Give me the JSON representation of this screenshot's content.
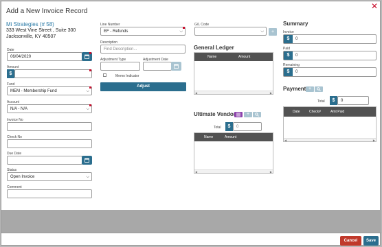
{
  "dialog": {
    "title": "Add a New Invoice Record"
  },
  "vendor": {
    "name": "Mi Strategies (# 58)",
    "address1": "333 West Vine Street , Suite 300",
    "address2": "Jacksonville, KY 40507"
  },
  "left": {
    "date_label": "Date",
    "date_value": "06/04/2020",
    "amount_label": "Amount",
    "amount_value": "",
    "fund_label": "Fund",
    "fund_value": "MEM - Membership Fund",
    "account_label": "Account",
    "account_value": "N/A - N/A",
    "invoice_no_label": "Invoice No",
    "check_no_label": "Check No",
    "due_date_label": "Due Date",
    "status_label": "Status",
    "status_value": "Open Invoice",
    "comment_label": "Comment"
  },
  "middle": {
    "line_number_label": "Line Number",
    "line_number_value": "EF - Refunds",
    "description_label": "Description",
    "description_placeholder": "Find Description...",
    "adj_type_label": "Adjustment Type",
    "adj_date_label": "Adjustment Date",
    "memo_label": "Memo Indicator",
    "adjust_button": "Adjust"
  },
  "gl": {
    "label": "G/L Code",
    "ledger_title": "General Ledger",
    "columns": [
      "Name",
      "Amount"
    ]
  },
  "ultimate_vendor": {
    "title": "Ultimate Vendor",
    "total_label": "Total",
    "total_value": "0",
    "columns": [
      "Name",
      "Amount"
    ]
  },
  "summary": {
    "title": "Summary",
    "invoice_label": "Invoice",
    "invoice_value": "0",
    "paid_label": "Paid",
    "paid_value": "0",
    "remaining_label": "Remaining",
    "remaining_value": "0"
  },
  "payment": {
    "title": "Payment",
    "total_label": "Total",
    "total_value": "0",
    "columns": [
      "Date",
      "Check#",
      "Amt Paid"
    ]
  },
  "footer": {
    "cancel": "Cancel",
    "save": "Save"
  },
  "icons": {
    "dollar": "$",
    "plus": "+",
    "caret": "⌵",
    "close": "✕"
  },
  "colors": {
    "accent": "#2b6e8e",
    "danger": "#c0392b",
    "purple": "#8e44ad"
  }
}
